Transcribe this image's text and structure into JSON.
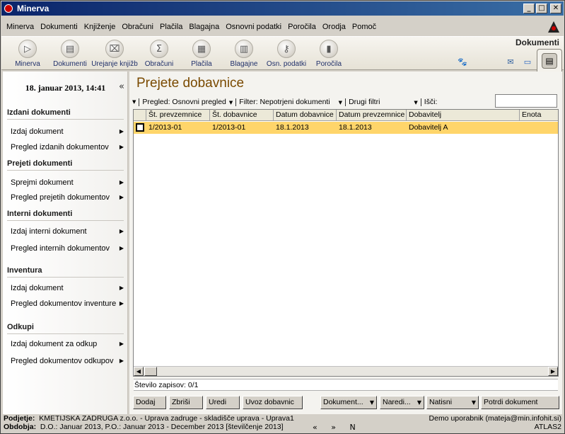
{
  "window": {
    "title": "Minerva"
  },
  "menu": [
    "Minerva",
    "Dokumenti",
    "Knjiženje",
    "Obračuni",
    "Plačila",
    "Blagajna",
    "Osnovni podatki",
    "Poročila",
    "Orodja",
    "Pomoč"
  ],
  "toolbar": {
    "items": [
      {
        "label": "Minerva",
        "icon": "play-icon"
      },
      {
        "label": "Dokumenti",
        "icon": "document-icon"
      },
      {
        "label": "Urejanje knjižb",
        "icon": "books-icon"
      },
      {
        "label": "Obračuni",
        "icon": "calculator-icon"
      },
      {
        "label": "Plačila",
        "icon": "payment-icon"
      },
      {
        "label": "Blagajne",
        "icon": "cashbox-icon"
      },
      {
        "label": "Osn. podatki",
        "icon": "key-icon"
      },
      {
        "label": "Poročila",
        "icon": "bar-chart-icon"
      }
    ],
    "active_tab": "Dokumenti"
  },
  "sidebar": {
    "date": "18. januar 2013, 14:41",
    "collapse_glyph": "«",
    "sections": [
      {
        "title": "Izdani dokumenti",
        "items": [
          "Izdaj dokument",
          "Pregled izdanih dokumentov"
        ]
      },
      {
        "title": "Prejeti dokumenti",
        "items": [
          "Sprejmi dokument",
          "Pregled prejetih dokumentov"
        ]
      },
      {
        "title": "Interni dokumenti",
        "items": [
          "Izdaj interni dokument",
          "Pregled internih dokumentov"
        ]
      },
      {
        "title": "Inventura",
        "items": [
          "Izdaj dokument",
          "Pregled dokumentov inventure"
        ]
      },
      {
        "title": "Odkupi",
        "items": [
          "Izdaj dokument za odkup",
          "Pregled dokumentov odkupov"
        ]
      }
    ]
  },
  "main": {
    "title": "Prejete dobavnice",
    "filters": {
      "view": "Pregled: Osnovni pregled",
      "filter": "Filter: Nepotrjeni dokumenti",
      "other": "Drugi filtri",
      "search_label": "Išči:",
      "search_value": ""
    },
    "columns": [
      "Št. prevzemnice",
      "Št. dobavnice",
      "Datum dobavnice",
      "Datum prevzemnice",
      "Dobavitelj",
      "Enota"
    ],
    "rows": [
      [
        "1/2013-01",
        "1/2013-01",
        "18.1.2013",
        "18.1.2013",
        "Dobavitelj A",
        ""
      ]
    ],
    "record_count": "Število zapisov: 0/1",
    "buttons": {
      "add": "Dodaj",
      "delete": "Zbriši",
      "edit": "Uredi",
      "import": "Uvoz dobavnic",
      "document": "Dokument...",
      "order": "Naredi...",
      "print": "Natisni",
      "confirm": "Potrdi dokument"
    }
  },
  "status": {
    "company_label": "Podjetje:",
    "company": "KMETIJSKA ZADRUGA z.o.o. - Uprava zadruge - skladišče uprava - Uprava1",
    "period_label": "Obdobja:",
    "period": "D.O.: Januar 2013, P.O.: Januar 2013 - December 2013 [številčenje 2013]",
    "user": "Demo uporabnik (mateja@min.infohit.si)",
    "db": "ATLAS2",
    "nav": [
      "«",
      "»",
      "N"
    ]
  }
}
